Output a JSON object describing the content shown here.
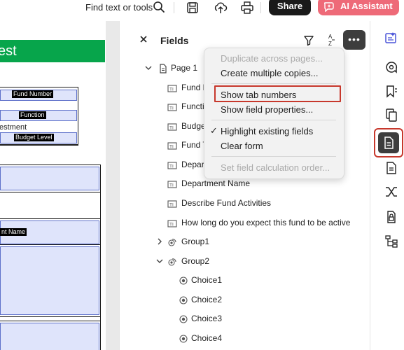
{
  "toolbar": {
    "find_text": "Find text or tools",
    "share_label": "Share",
    "ai_label": "AI Assistant",
    "colors": {
      "share_bg": "#1a1a1a",
      "ai_bg": "#ee6a78"
    }
  },
  "document": {
    "banner_text": "est",
    "fields": {
      "fund_number": "Fund Number",
      "function": "Function",
      "investment_text": "estment",
      "budget_level": "Budget Level",
      "department_name": "nt Name"
    },
    "colors": {
      "banner": "#07a54b",
      "field_fill": "#dfe4fb"
    }
  },
  "panel": {
    "title": "Fields",
    "page_label": "Page 1",
    "items": [
      {
        "label": "Fund N",
        "icon": "text-field-icon"
      },
      {
        "label": "Functi",
        "icon": "text-field-icon"
      },
      {
        "label": "Budge",
        "icon": "text-field-icon"
      },
      {
        "label": "Fund T",
        "icon": "text-field-icon"
      },
      {
        "label": "Depart",
        "icon": "text-field-icon"
      },
      {
        "label": "Department Name",
        "icon": "text-field-icon"
      },
      {
        "label": "Describe Fund Activities",
        "icon": "text-field-icon"
      },
      {
        "label": "How long do you expect this fund to be active",
        "icon": "text-field-icon"
      }
    ],
    "group1": "Group1",
    "group2": "Group2",
    "choices": [
      "Choice1",
      "Choice2",
      "Choice3",
      "Choice4"
    ]
  },
  "menu": {
    "items": {
      "duplicate": "Duplicate across pages...",
      "create_copies": "Create multiple copies...",
      "show_tab_numbers": "Show tab numbers",
      "show_properties": "Show field properties...",
      "highlight_fields": "Highlight existing fields",
      "clear_form": "Clear form",
      "set_calc_order": "Set field calculation order..."
    },
    "checkmark": "✓",
    "highlight_color": "#c7382c"
  },
  "rail": {
    "icons": [
      "edit-pdf-icon",
      "comment-icon",
      "bookmark-icon",
      "organize-pages-icon",
      "prepare-form-icon",
      "export-pdf-icon",
      "compare-icon",
      "protect-icon",
      "more-tools-icon"
    ],
    "active": "prepare-form-icon"
  }
}
